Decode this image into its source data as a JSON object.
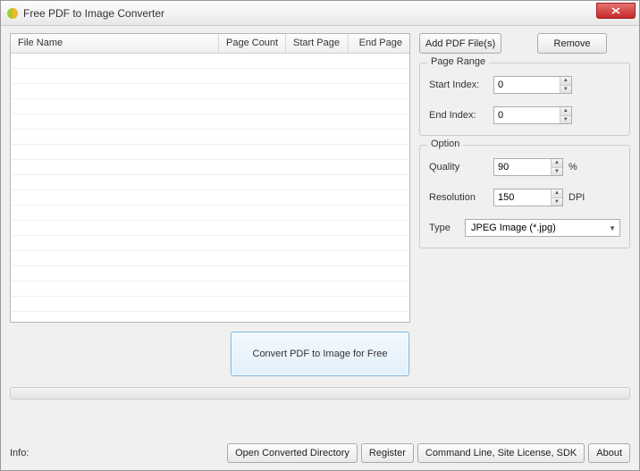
{
  "title": "Free PDF to Image Converter",
  "table": {
    "cols": {
      "file_name": "File Name",
      "page_count": "Page Count",
      "start_page": "Start Page",
      "end_page": "End Page"
    }
  },
  "buttons": {
    "add": "Add PDF File(s)",
    "remove": "Remove",
    "convert": "Convert PDF to Image for Free",
    "open_dir": "Open Converted Directory",
    "register": "Register",
    "cmdline": "Command Line, Site License, SDK",
    "about": "About"
  },
  "page_range": {
    "title": "Page Range",
    "start_label": "Start Index:",
    "start_value": "0",
    "end_label": "End Index:",
    "end_value": "0"
  },
  "option": {
    "title": "Option",
    "quality_label": "Quality",
    "quality_value": "90",
    "quality_unit": "%",
    "resolution_label": "Resolution",
    "resolution_value": "150",
    "resolution_unit": "DPI",
    "type_label": "Type",
    "type_value": "JPEG Image (*.jpg)"
  },
  "footer": {
    "info": "Info:"
  }
}
